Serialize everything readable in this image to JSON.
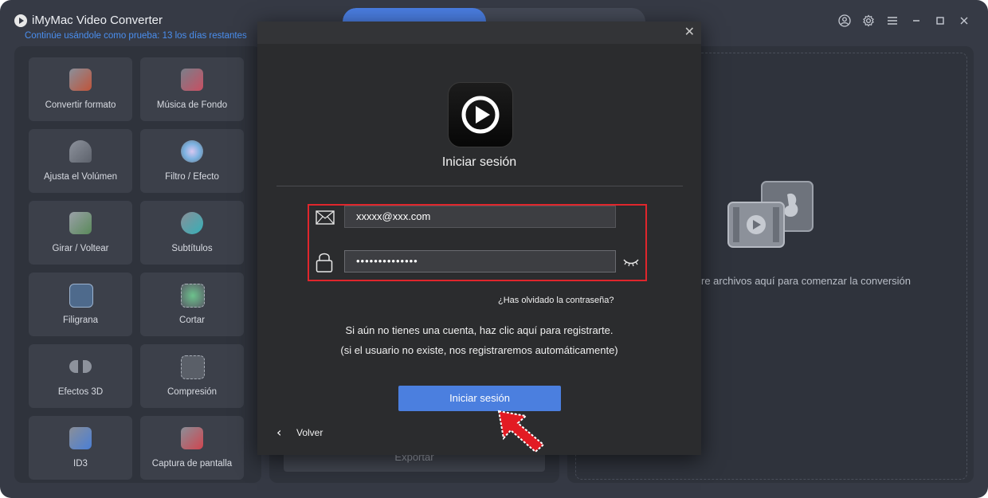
{
  "app": {
    "title": "iMyMac Video Converter",
    "trial_notice": "Continúe usándole como prueba: 13 los días restantes"
  },
  "window_controls": [
    "account-icon",
    "settings-icon",
    "menu-icon",
    "minimize-icon",
    "maximize-icon",
    "close-icon"
  ],
  "sidebar": {
    "tools": [
      {
        "label": "Convertir formato",
        "icon": "convert-format-icon"
      },
      {
        "label": "Música de Fondo",
        "icon": "background-music-icon"
      },
      {
        "label": "Ajusta el Volúmen",
        "icon": "volume-icon"
      },
      {
        "label": "Filtro / Efecto",
        "icon": "filter-effect-icon"
      },
      {
        "label": "Girar / Voltear",
        "icon": "rotate-flip-icon"
      },
      {
        "label": "Subtítulos",
        "icon": "subtitles-icon"
      },
      {
        "label": "Filigrana",
        "icon": "watermark-icon"
      },
      {
        "label": "Cortar",
        "icon": "crop-icon"
      },
      {
        "label": "Efectos 3D",
        "icon": "3d-glasses-icon"
      },
      {
        "label": "Compresión",
        "icon": "compress-icon"
      },
      {
        "label": "ID3",
        "icon": "id3-edit-icon"
      },
      {
        "label": "Captura de pantalla",
        "icon": "screen-capture-icon"
      }
    ]
  },
  "middle": {
    "export_label": "Exportar"
  },
  "drop_zone": {
    "text": "re archivos aquí para comenzar la conversión",
    "icon": "video-music-files-icon"
  },
  "login_dialog": {
    "title": "Iniciar sesión",
    "email_value": "xxxxx@xxx.com",
    "password_value": "••••••••••••••",
    "forgot_password": "¿Has olvidado la contraseña?",
    "register_line1": "Si aún no tienes una cuenta, haz clic aquí para registrarte.",
    "register_line2": "(si el usuario no existe, nos registraremos automáticamente)",
    "login_button": "Iniciar sesión",
    "back_label": "Volver",
    "highlight_color": "#e0262c",
    "accent_color": "#4b7fdf"
  }
}
